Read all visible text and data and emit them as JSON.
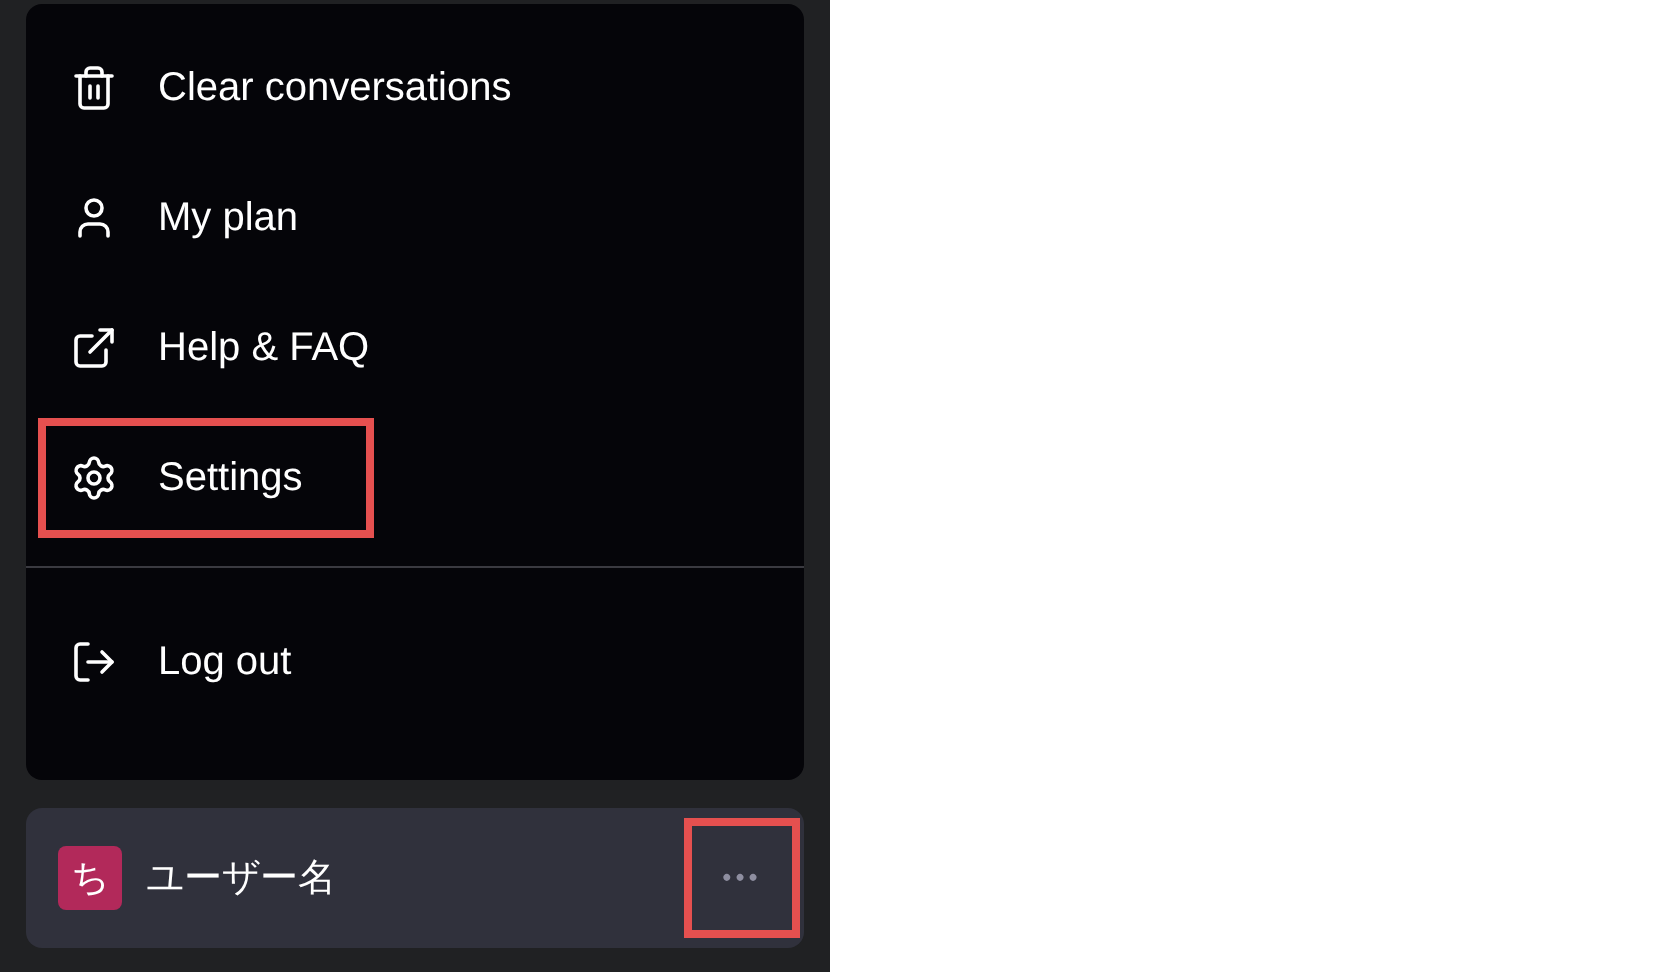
{
  "menu": {
    "groups": [
      {
        "items": [
          {
            "kind": "trash",
            "label": "Clear conversations",
            "highlighted": false
          },
          {
            "kind": "user",
            "label": "My plan",
            "highlighted": false
          },
          {
            "kind": "external",
            "label": "Help & FAQ",
            "highlighted": false
          },
          {
            "kind": "settings",
            "label": "Settings",
            "highlighted": true
          }
        ]
      },
      {
        "items": [
          {
            "kind": "logout",
            "label": "Log out",
            "highlighted": false
          }
        ]
      }
    ]
  },
  "account": {
    "avatar_letter": "ち",
    "name": "ユーザー名",
    "more_button": {
      "label": "•••",
      "highlighted": true
    }
  }
}
